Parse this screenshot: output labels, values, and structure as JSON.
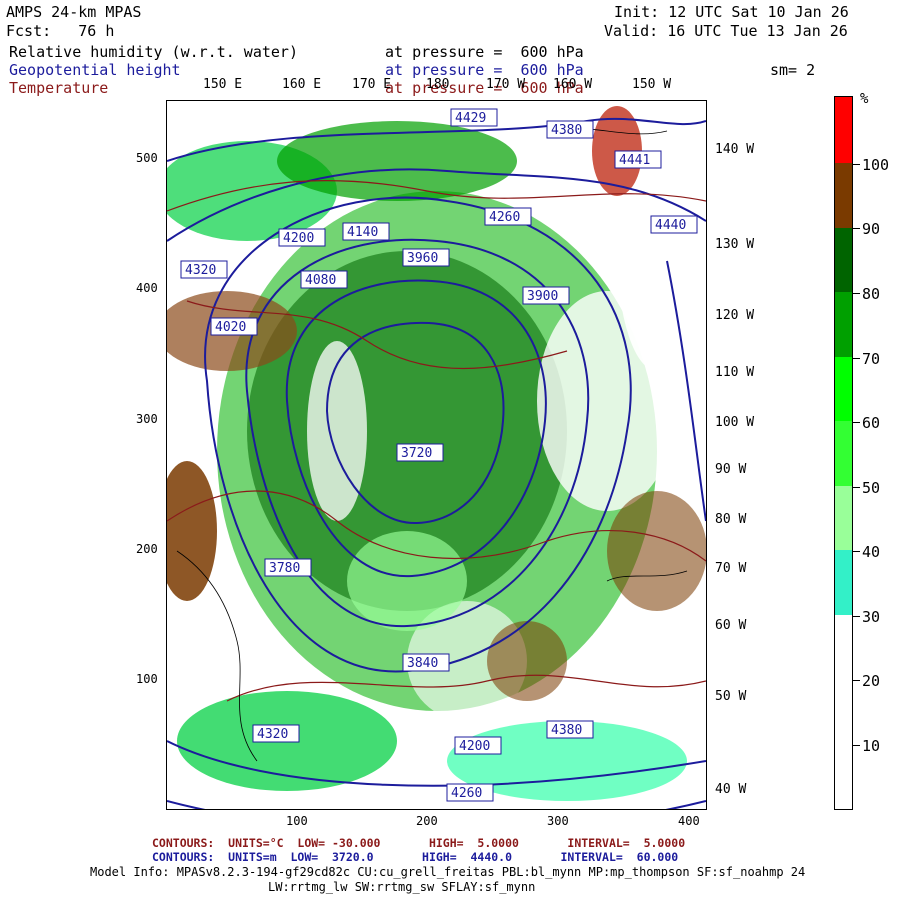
{
  "header": {
    "model": "AMPS 24-km MPAS",
    "fcst": "Fcst:   76 h",
    "init": "Init: 12 UTC Sat 10 Jan 26",
    "valid": "Valid: 16 UTC Tue 13 Jan 26",
    "smoothing": "sm= 2"
  },
  "fields": [
    {
      "name": "Relative humidity (w.r.t. water)",
      "level": "at pressure =  600 hPa",
      "color": "#000000"
    },
    {
      "name": "Geopotential height",
      "level": "at pressure =  600 hPa",
      "color": "#1c1c9c"
    },
    {
      "name": "Temperature",
      "level": "at pressure =  600 hPa",
      "color": "#8b1a1a"
    }
  ],
  "axes": {
    "x_ticks": [
      "100",
      "200",
      "300",
      "400"
    ],
    "y_ticks": [
      "100",
      "200",
      "300",
      "400",
      "500"
    ],
    "top_lon": [
      "150 E",
      "160 E",
      "170 E",
      "180",
      "170 W",
      "160 W",
      "150 W"
    ],
    "right_lon": [
      "140 W",
      "130 W",
      "120 W",
      "110 W",
      "100 W",
      "90 W",
      "80 W",
      "70 W",
      "60 W",
      "50 W",
      "40 W"
    ]
  },
  "colorbar": {
    "unit": "%",
    "labels": [
      "10",
      "20",
      "30",
      "40",
      "50",
      "60",
      "70",
      "80",
      "90",
      "100"
    ],
    "colors": [
      "#ffffff",
      "#ffffff",
      "#ffffff",
      "#33f0c8",
      "#99ff99",
      "#33ff33",
      "#00ff00",
      "#00a000",
      "#006400",
      "#7a3a00",
      "#ff0000"
    ]
  },
  "height_labels": [
    "4429",
    "4380",
    "4320",
    "4441",
    "4440",
    "4200",
    "4140",
    "4260",
    "3960",
    "4020",
    "4080",
    "3900",
    "3840",
    "3720",
    "3780",
    "4380",
    "4320",
    "4260",
    "4200"
  ],
  "footer": {
    "temp_contours": "CONTOURS:  UNITS=°C  LOW= -30.000       HIGH=  5.0000       INTERVAL=  5.0000",
    "height_contours": "CONTOURS:  UNITS=m  LOW=  3720.0       HIGH=  4440.0       INTERVAL=  60.000",
    "model_info": "Model Info: MPASv8.2.3-194-gf29cd82c CU:cu_grell_freitas PBL:bl_mynn MP:mp_thompson SF:sf_noahmp 24",
    "model_info2": "LW:rrtmg_lw SW:rrtmg_sw SFLAY:sf_mynn"
  }
}
